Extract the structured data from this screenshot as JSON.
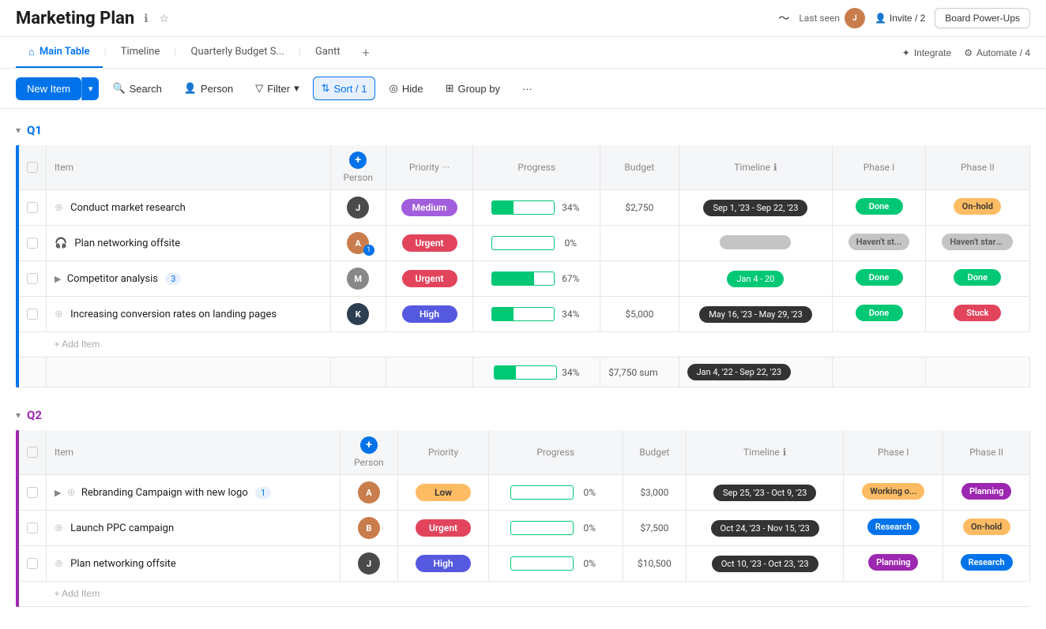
{
  "header": {
    "title": "Marketing Plan",
    "info_icon": "ℹ",
    "star_icon": "☆",
    "last_seen_label": "Last seen",
    "invite_label": "Invite / 2",
    "board_powerups_label": "Board Power-Ups",
    "trend_icon": "~"
  },
  "tabs": [
    {
      "label": "Main Table",
      "icon": "⌂",
      "active": true
    },
    {
      "label": "Timeline",
      "active": false
    },
    {
      "label": "Quarterly Budget S...",
      "active": false
    },
    {
      "label": "Gantt",
      "active": false
    }
  ],
  "tabs_add": "+",
  "tabs_right": [
    {
      "label": "Integrate",
      "icon": "✦"
    },
    {
      "label": "Automate / 4",
      "icon": "⚙"
    }
  ],
  "toolbar": {
    "new_item": "New Item",
    "search": "Search",
    "person": "Person",
    "filter": "Filter",
    "sort": "Sort / 1",
    "hide": "Hide",
    "group_by": "Group by",
    "more": "···"
  },
  "groups": [
    {
      "id": "q1",
      "title": "Q1",
      "color": "#0073ea",
      "columns": [
        "Item",
        "Person",
        "Priority",
        "Progress",
        "Budget",
        "Timeline",
        "Phase I",
        "Phase II"
      ],
      "rows": [
        {
          "item": "Conduct market research",
          "person_color": "#4a4a4a",
          "person_initial": "J",
          "priority": "Medium",
          "priority_class": "priority-medium",
          "progress": 34,
          "budget": "$2,750",
          "timeline": "Sep 1, '23 - Sep 22, '23",
          "timeline_class": "",
          "phase1": "Done",
          "phase1_class": "phase-done",
          "phase2": "On-hold",
          "phase2_class": "phase-onhold",
          "has_expand": false,
          "has_add": true
        },
        {
          "item": "Plan networking offsite",
          "person_color": "#c97d4c",
          "person_initial": "A",
          "has_headphone": true,
          "priority": "Urgent",
          "priority_class": "priority-urgent",
          "progress": 0,
          "budget": "",
          "timeline": "",
          "timeline_class": "gray",
          "phase1": "Haven't st...",
          "phase1_class": "phase-haventst",
          "phase2": "Haven't start...",
          "phase2_class": "phase-haventst",
          "has_expand": false,
          "has_add": false
        },
        {
          "item": "Competitor analysis",
          "sub_count": "3",
          "person_color": "#8e44ad",
          "person_initial": "M",
          "priority": "Urgent",
          "priority_class": "priority-urgent",
          "progress": 67,
          "budget": "",
          "timeline": "Jan 4 - 20",
          "timeline_class": "green",
          "phase1": "Done",
          "phase1_class": "phase-done",
          "phase2": "Done",
          "phase2_class": "phase-done",
          "has_expand": true,
          "has_add": false
        },
        {
          "item": "Increasing conversion rates on landing pages",
          "person_color": "#2c3e50",
          "person_initial": "K",
          "priority": "High",
          "priority_class": "priority-high",
          "progress": 34,
          "budget": "$5,000",
          "timeline": "May 16, '23 - May 29, '23",
          "timeline_class": "",
          "phase1": "Done",
          "phase1_class": "phase-done",
          "phase2": "Stuck",
          "phase2_class": "phase-stuck",
          "has_expand": false,
          "has_add": true
        }
      ],
      "summary": {
        "progress": 34,
        "budget": "$7,750",
        "budget_label": "sum",
        "timeline": "Jan 4, '22 - Sep 22, '23"
      },
      "add_item": "+ Add Item"
    },
    {
      "id": "q2",
      "title": "Q2",
      "color": "#9c27b0",
      "columns": [
        "Item",
        "Person",
        "Priority",
        "Progress",
        "Budget",
        "Timeline",
        "Phase I",
        "Phase II"
      ],
      "rows": [
        {
          "item": "Rebranding Campaign with new logo",
          "sub_count": "1",
          "person_color": "#c97d4c",
          "person_initial": "A",
          "priority": "Low",
          "priority_class": "priority-low",
          "progress": 0,
          "budget": "$3,000",
          "timeline": "Sep 25, '23 - Oct 9, '23",
          "timeline_class": "",
          "phase1": "Working o...",
          "phase1_class": "phase-working",
          "phase2": "Planning",
          "phase2_class": "phase-planning",
          "has_expand": true,
          "has_add": true
        },
        {
          "item": "Launch PPC campaign",
          "person_color": "#c97d4c",
          "person_initial": "B",
          "priority": "Urgent",
          "priority_class": "priority-urgent",
          "progress": 0,
          "budget": "$7,500",
          "timeline": "Oct 24, '23 - Nov 15, '23",
          "timeline_class": "",
          "phase1": "Research",
          "phase1_class": "phase-research",
          "phase2": "On-hold",
          "phase2_class": "phase-onhold",
          "has_expand": false,
          "has_add": true
        },
        {
          "item": "Plan networking offsite",
          "person_color": "#4a4a4a",
          "person_initial": "J",
          "priority": "High",
          "priority_class": "priority-high",
          "progress": 0,
          "budget": "$10,500",
          "timeline": "Oct 10, '23 - Oct 23, '23",
          "timeline_class": "",
          "phase1": "Planning",
          "phase1_class": "phase-planning",
          "phase2": "Research",
          "phase2_class": "phase-research",
          "has_expand": false,
          "has_add": false
        }
      ],
      "add_item": "+ Add Item"
    }
  ]
}
